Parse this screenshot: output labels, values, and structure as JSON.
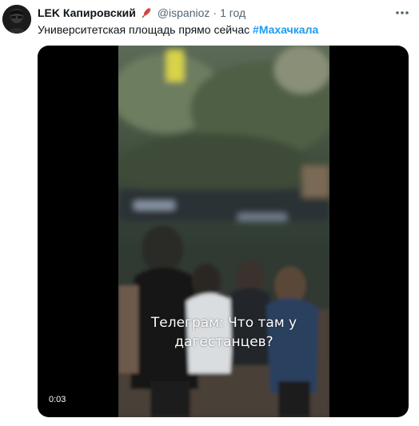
{
  "tweet": {
    "display_name": "LEK Капировский",
    "name_emoji": "feather-icon",
    "username": "@ispanioz",
    "separator": "·",
    "time": "1 год",
    "text": "Университетская площадь прямо сейчас",
    "hashtag": "#Махачкала"
  },
  "video": {
    "caption_line1": "Телеграм: Что там у",
    "caption_line2": "дагестанцев?",
    "timestamp": "0:03"
  },
  "colors": {
    "text": "#0f1419",
    "secondary": "#536471",
    "hashtag": "#1d9bf0",
    "media_bg": "#000000"
  }
}
